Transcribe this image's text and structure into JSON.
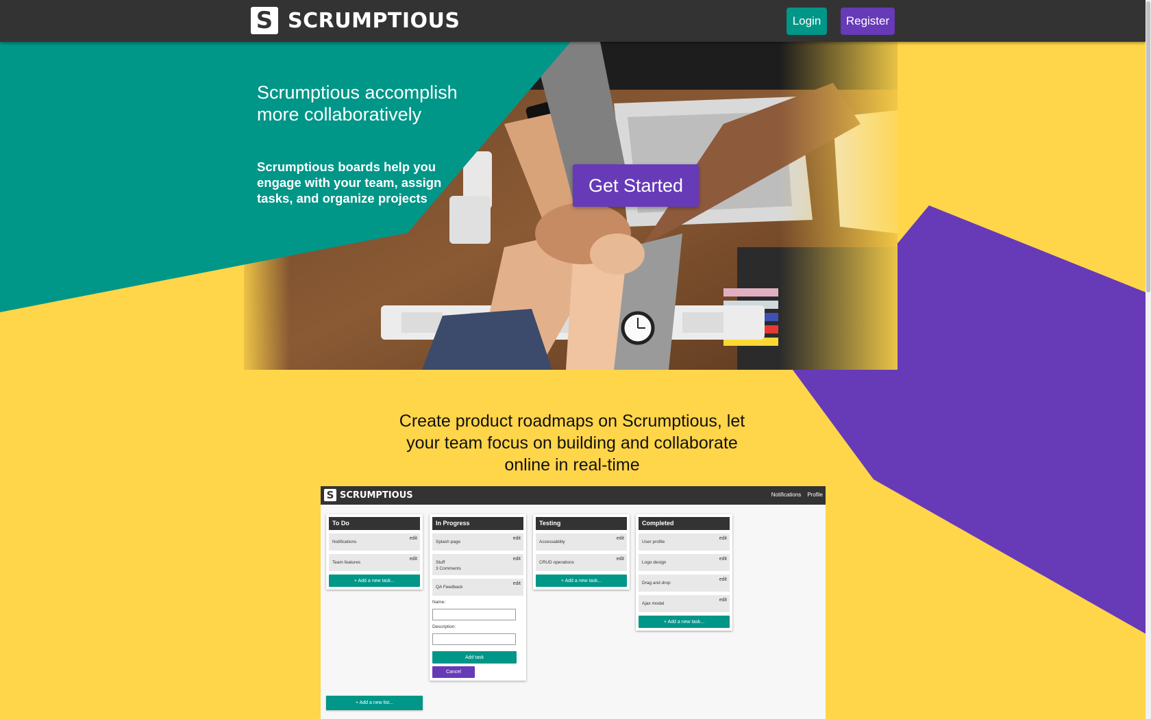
{
  "navbar": {
    "brand": "SCRUMPTIOUS",
    "brand_mark": "S",
    "login_label": "Login",
    "register_label": "Register"
  },
  "hero": {
    "title": "Scrumptious accomplish more collaboratively",
    "subtitle": "Scrumptious boards help you engage with your team, assign tasks, and organize projects",
    "cta_label": "Get Started",
    "photo_icon": "teamwork-fist-bump-photo"
  },
  "section": {
    "heading": "Create product roadmaps on Scrumptious, let your team focus on building and collaborate online in real-time"
  },
  "preview": {
    "brand": "SCRUMPTIOUS",
    "brand_mark": "S",
    "nav": [
      "Notifications",
      "Profile"
    ],
    "lists": [
      {
        "title": "To Do",
        "cards": [
          {
            "name": "Notifications",
            "edit": "edit"
          },
          {
            "name": "Team features",
            "edit": "edit"
          }
        ],
        "add_label": "+ Add a new task..."
      },
      {
        "title": "In Progress",
        "cards": [
          {
            "name": "Splash page",
            "edit": "edit"
          },
          {
            "name": "Stuff",
            "extra": "3 Comments",
            "edit": "edit"
          },
          {
            "name": "QA Feedback",
            "edit": "edit"
          }
        ],
        "form": {
          "name_label": "Name:",
          "description_label": "Description:",
          "add_label": "Add task",
          "cancel_label": "Cancel"
        }
      },
      {
        "title": "Testing",
        "cards": [
          {
            "name": "Accessability",
            "edit": "edit"
          },
          {
            "name": "CRUD operations",
            "edit": "edit"
          }
        ],
        "add_label": "+ Add a new task..."
      },
      {
        "title": "Completed",
        "cards": [
          {
            "name": "User profile",
            "edit": "edit"
          },
          {
            "name": "Logo design",
            "edit": "edit"
          },
          {
            "name": "Drag and drop",
            "edit": "edit"
          },
          {
            "name": "Ajax modal",
            "edit": "edit"
          }
        ],
        "add_label": "+ Add a new task..."
      }
    ],
    "add_list_label": "+ Add a new list..."
  },
  "colors": {
    "background_yellow": "#ffd54a",
    "teal": "#009688",
    "purple": "#673ab7",
    "dark_bar": "#333333"
  }
}
